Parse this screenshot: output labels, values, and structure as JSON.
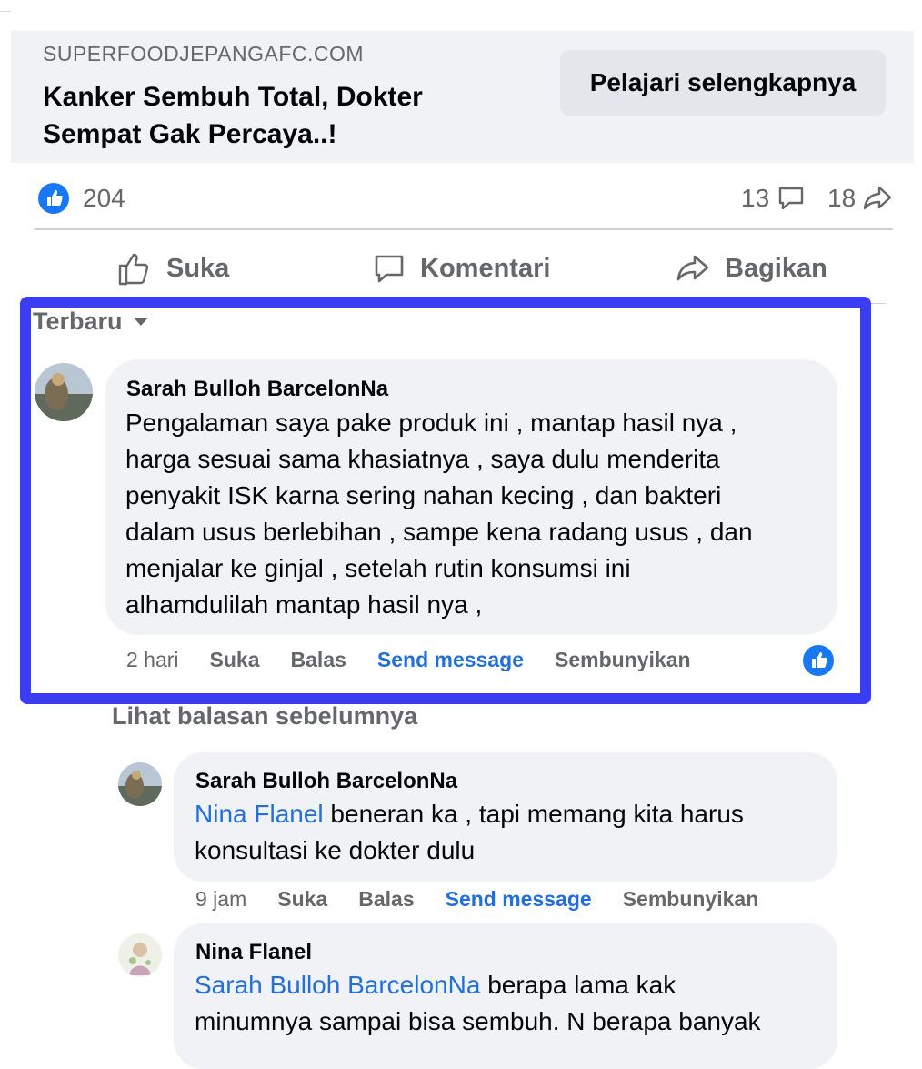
{
  "ad": {
    "domain": "SUPERFOODJEPANGAFC.COM",
    "title": "Kanker Sembuh Total, Dokter Sempat Gak Percaya..!",
    "cta": "Pelajari selengkapnya"
  },
  "stats": {
    "likes": "204",
    "comments": "13",
    "shares": "18"
  },
  "actions": {
    "like": "Suka",
    "comment": "Komentari",
    "share": "Bagikan"
  },
  "sort_label": "Terbaru",
  "comments": [
    {
      "author": "Sarah Bulloh BarcelonNa",
      "lines": [
        "Pengalaman saya pake produk ini , mantap hasil nya ,",
        "harga sesuai sama khasiatnya , saya dulu menderita",
        "penyakit ISK karna sering nahan kecing , dan bakteri",
        "dalam usus berlebihan , sampe kena radang usus , dan",
        "menjalar ke ginjal , setelah rutin konsumsi ini",
        "alhamdulilah mantap hasil nya ,"
      ],
      "time": "2 hari",
      "like": "Suka",
      "reply": "Balas",
      "send": "Send message",
      "hide": "Sembunyikan"
    }
  ],
  "more_replies": "Lihat balasan sebelumnya",
  "replies": [
    {
      "author": "Sarah Bulloh BarcelonNa",
      "mention": "Nina Flanel",
      "line1_rest": " beneran ka , tapi memang kita harus",
      "line2": "konsultasi ke dokter dulu",
      "time": "9 jam",
      "like": "Suka",
      "reply": "Balas",
      "send": "Send message",
      "hide": "Sembunyikan"
    },
    {
      "author": "Nina Flanel",
      "mention": "Sarah Bulloh BarcelonNa",
      "line1_rest": " berapa lama kak",
      "line2": "minumnya sampai bisa sembuh. N berapa banyak"
    }
  ],
  "colors": {
    "accent": "#1877f2",
    "highlight_border": "#3a3ef0",
    "link": "#216fdb",
    "muted": "#65676b"
  }
}
